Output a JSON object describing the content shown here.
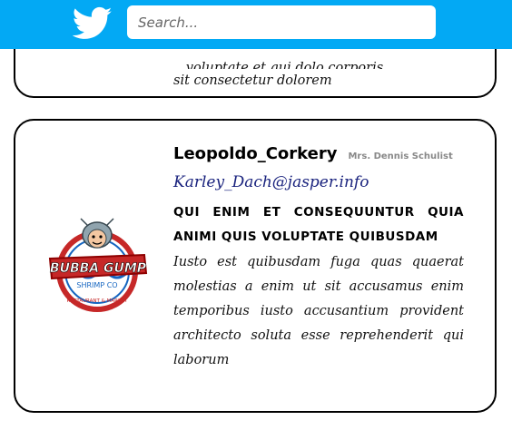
{
  "header": {
    "logo_icon": "twitter-bird-icon",
    "search_placeholder": "Search..."
  },
  "colors": {
    "topbar": "#03a9f4",
    "email": "#1a237e",
    "fullname": "#888888"
  },
  "previous_post": {
    "partial_line": "...voluptate et qui dolo corporis",
    "last_line": "sit consectetur dolorem"
  },
  "post": {
    "username": "Leopoldo_Corkery",
    "full_name": "Mrs. Dennis Schulist",
    "email": "Karley_Dach@jasper.info",
    "title": "QUI ENIM ET CONSEQUUNTUR QUIA ANIMI QUIS VOLUPTATE QUIBUSDAM",
    "body": "Iusto est quibusdam fuga quas quaerat molestias a enim ut sit accusamus enim temporibus iusto accusantium provident architecto soluta esse reprehenderit qui laborum",
    "avatar": {
      "icon": "bubba-gump-logo",
      "alt": "BUBBA GUMP SHRIMP CO RESTAURANT & MARKET"
    }
  }
}
